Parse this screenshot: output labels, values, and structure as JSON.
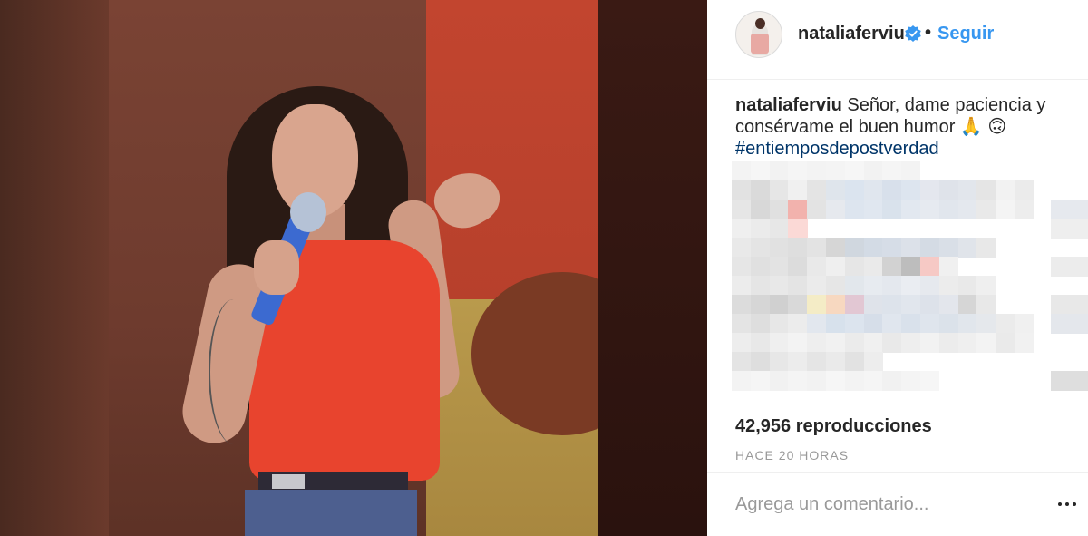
{
  "header": {
    "username": "nataliaferviu",
    "separator": "•",
    "follow_label": "Seguir",
    "verified_icon": "verified-badge-icon"
  },
  "caption": {
    "username": "nataliaferviu",
    "text": "Señor, dame paciencia y consérvame el buen humor 🙏 🙃",
    "hashtag": "#entiemposdepostverdad"
  },
  "stats": {
    "views": "42,956 reproducciones",
    "time": "HACE 20 HORAS"
  },
  "comment": {
    "placeholder": "Agrega un comentario..."
  },
  "colors": {
    "follow_blue": "#3897f0",
    "hashtag_blue": "#003569",
    "shirt_red": "#e8442e"
  }
}
